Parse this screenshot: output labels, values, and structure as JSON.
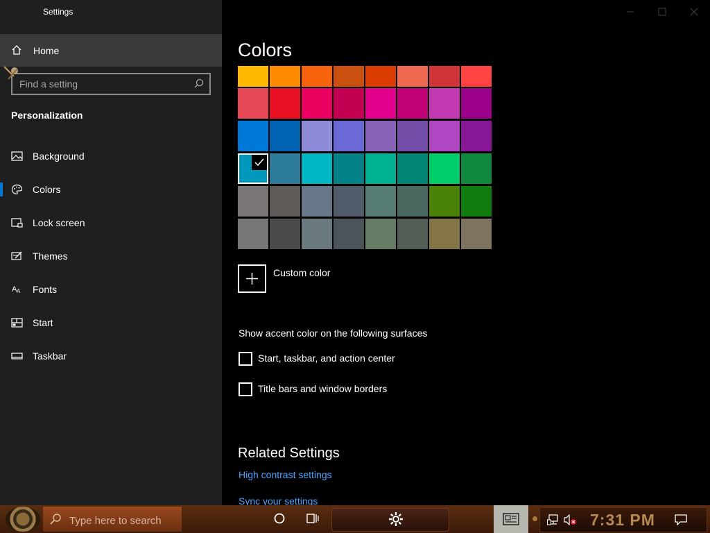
{
  "window": {
    "title": "Settings"
  },
  "sidebar": {
    "home_label": "Home",
    "search_placeholder": "Find a setting",
    "section_title": "Personalization",
    "items": [
      {
        "label": "Background",
        "icon": "image-icon"
      },
      {
        "label": "Colors",
        "icon": "palette-icon",
        "active": true
      },
      {
        "label": "Lock screen",
        "icon": "lock-screen-icon"
      },
      {
        "label": "Themes",
        "icon": "themes-icon"
      },
      {
        "label": "Fonts",
        "icon": "fonts-icon"
      },
      {
        "label": "Start",
        "icon": "start-icon"
      },
      {
        "label": "Taskbar",
        "icon": "taskbar-icon"
      }
    ]
  },
  "main": {
    "title": "Colors",
    "swatches": [
      [
        "#FFB900",
        "#FF8C00",
        "#F7630C",
        "#CA5010",
        "#DA3B01",
        "#EF6950",
        "#D13438",
        "#FF4343"
      ],
      [
        "#E74856",
        "#E81123",
        "#EA005E",
        "#C30052",
        "#E3008C",
        "#BF0077",
        "#C239B3",
        "#9A0089"
      ],
      [
        "#0078D7",
        "#0063B1",
        "#8E8CD8",
        "#6B69D6",
        "#8764B8",
        "#744DA9",
        "#B146C2",
        "#881798"
      ],
      [
        "#0099BC",
        "#2D7D9A",
        "#00B7C3",
        "#038387",
        "#00B294",
        "#018574",
        "#00CC6A",
        "#10893E"
      ],
      [
        "#7A7574",
        "#5D5A58",
        "#68768A",
        "#515C6B",
        "#567C73",
        "#486860",
        "#498205",
        "#107C10"
      ],
      [
        "#767676",
        "#4C4A48",
        "#69797E",
        "#4A5459",
        "#647C64",
        "#525E54",
        "#847545",
        "#7E735F"
      ]
    ],
    "selected_swatch": {
      "row": 3,
      "col": 0
    },
    "custom_color_label": "Custom color",
    "accent_heading": "Show accent color on the following surfaces",
    "checkboxes": [
      {
        "label": "Start, taskbar, and action center",
        "checked": false
      },
      {
        "label": "Title bars and window borders",
        "checked": false
      }
    ],
    "related_heading": "Related Settings",
    "links": [
      "High contrast settings",
      "Sync your settings"
    ]
  },
  "taskbar": {
    "search_placeholder": "Type here to search",
    "clock": "7:31 PM"
  }
}
